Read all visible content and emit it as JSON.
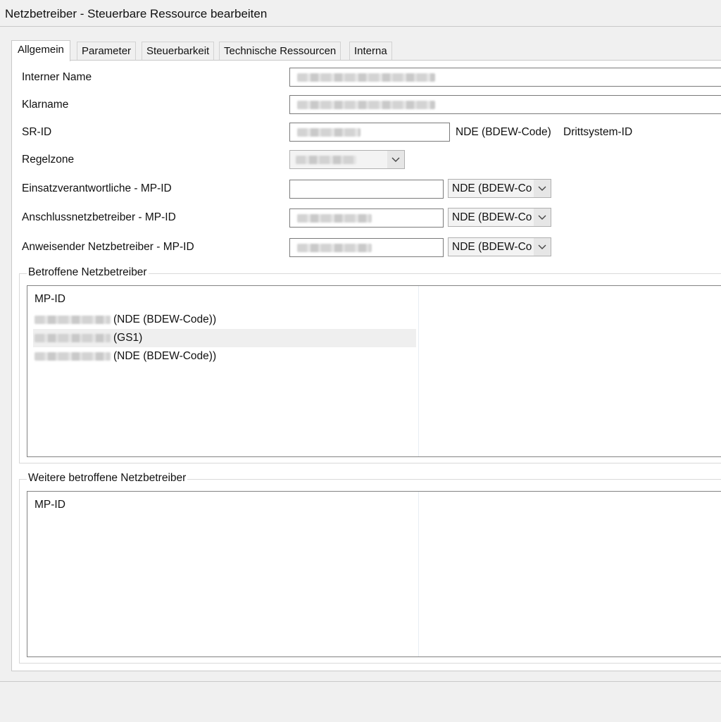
{
  "window": {
    "title": "Netzbetreiber - Steuerbare Ressource bearbeiten"
  },
  "tabs": [
    {
      "label": "Allgemein",
      "active": true
    },
    {
      "label": "Parameter",
      "active": false
    },
    {
      "label": "Steuerbarkeit",
      "active": false
    },
    {
      "label": "Technische Ressourcen",
      "active": false
    },
    {
      "label": "Interna",
      "active": false
    }
  ],
  "form": {
    "interner_name": {
      "label": "Interner Name"
    },
    "klarname": {
      "label": "Klarname"
    },
    "sr_id": {
      "label": "SR-ID",
      "code_type": "NDE (BDEW-Code)",
      "drittsystem_label": "Drittsystem-ID"
    },
    "regelzone": {
      "label": "Regelzone"
    },
    "einsatzverantwortliche": {
      "label": "Einsatzverantwortliche - MP-ID",
      "code_type": "NDE (BDEW-Co"
    },
    "anschlussnetzbetreiber": {
      "label": "Anschlussnetzbetreiber - MP-ID",
      "code_type": "NDE (BDEW-Co"
    },
    "anweisender_netzbetreiber": {
      "label": "Anweisender Netzbetreiber - MP-ID",
      "code_type": "NDE (BDEW-Co"
    }
  },
  "betroffene": {
    "legend": "Betroffene Netzbetreiber",
    "column_header": "MP-ID",
    "rows": [
      {
        "code": "(NDE (BDEW-Code))",
        "selected": false
      },
      {
        "code": "(GS1)",
        "selected": true
      },
      {
        "code": "(NDE (BDEW-Code))",
        "selected": false
      }
    ]
  },
  "weitere": {
    "legend": "Weitere betroffene Netzbetreiber",
    "column_header": "MP-ID"
  },
  "colors": {
    "border": "#7a7a7a",
    "panel": "#ffffff",
    "window": "#f0f0f0",
    "selection": "#efefef"
  },
  "icons": {
    "dropdown": "chevron-down-icon"
  }
}
